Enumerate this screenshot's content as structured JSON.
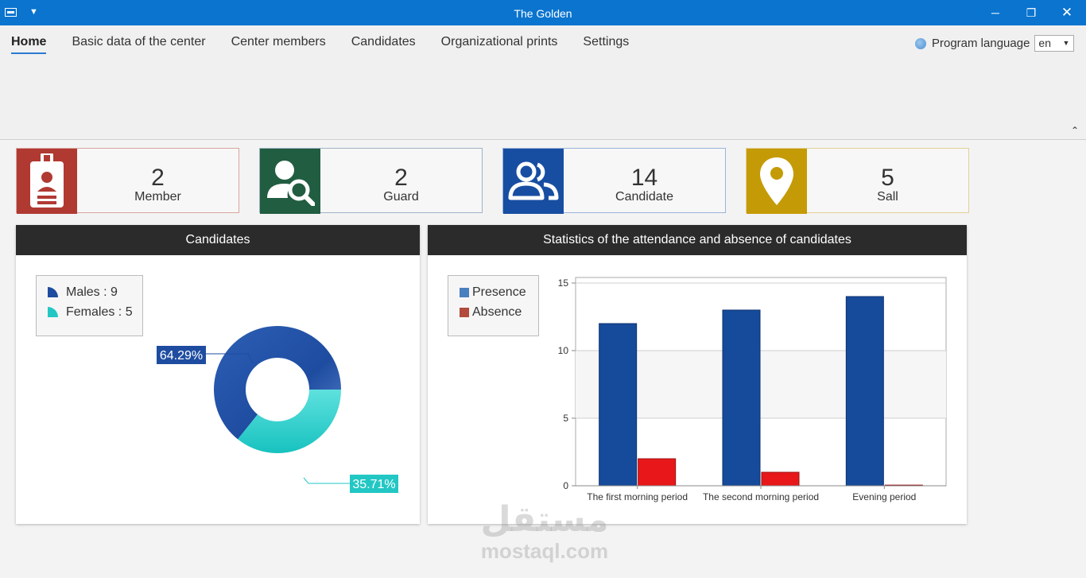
{
  "window": {
    "title": "The Golden"
  },
  "menu": {
    "items": [
      {
        "label": "Home",
        "active": true
      },
      {
        "label": "Basic data of the center"
      },
      {
        "label": "Center members"
      },
      {
        "label": "Candidates"
      },
      {
        "label": "Organizational prints"
      },
      {
        "label": "Settings"
      }
    ]
  },
  "language": {
    "label": "Program language",
    "value": "en"
  },
  "stats": [
    {
      "value": "2",
      "label": "Member",
      "color": "#b03a32",
      "icon": "id-badge-icon",
      "border": "#d9a6a2"
    },
    {
      "value": "2",
      "label": "Guard",
      "color": "#215d40",
      "icon": "user-search-icon",
      "border": "#9fb3c6"
    },
    {
      "value": "14",
      "label": "Candidate",
      "color": "#174ea2",
      "icon": "users-icon",
      "border": "#9ab2d8"
    },
    {
      "value": "5",
      "label": "Sall",
      "color": "#c49b06",
      "icon": "location-pin-icon",
      "border": "#e3cf95"
    }
  ],
  "candidates_panel": {
    "title": "Candidates",
    "legend": [
      {
        "label": "Males : 9",
        "color": "#1e4ca0"
      },
      {
        "label": "Females : 5",
        "color": "#22c7c4"
      }
    ],
    "pct_labels": {
      "males": "64.29%",
      "females": "35.71%"
    }
  },
  "attendance_panel": {
    "title": "Statistics of the attendance and absence of candidates",
    "legend": [
      {
        "label": "Presence",
        "color": "#4a7fc0"
      },
      {
        "label": "Absence",
        "color": "#b24b3e"
      }
    ]
  },
  "chart_data": [
    {
      "type": "pie",
      "categories": [
        "Males",
        "Females"
      ],
      "values": [
        9,
        5
      ],
      "data_labels": [
        "64.29%",
        "35.71%"
      ],
      "colors": [
        "#1e4ca0",
        "#22c7c4"
      ],
      "donut": true
    },
    {
      "type": "bar",
      "categories": [
        "The first morning period",
        "The second morning period",
        "Evening period"
      ],
      "series": [
        {
          "name": "Presence",
          "values": [
            12,
            13,
            14
          ],
          "color": "#164a9a"
        },
        {
          "name": "Absence",
          "values": [
            2,
            1,
            0.05
          ],
          "color": "#e8181a"
        }
      ],
      "ylim": [
        0,
        15
      ],
      "yticks": [
        "0",
        "5",
        "10",
        "15"
      ],
      "grid": true,
      "legend": "left"
    }
  ],
  "watermark": {
    "arabic": "مستقل",
    "latin": "mostaql.com"
  }
}
